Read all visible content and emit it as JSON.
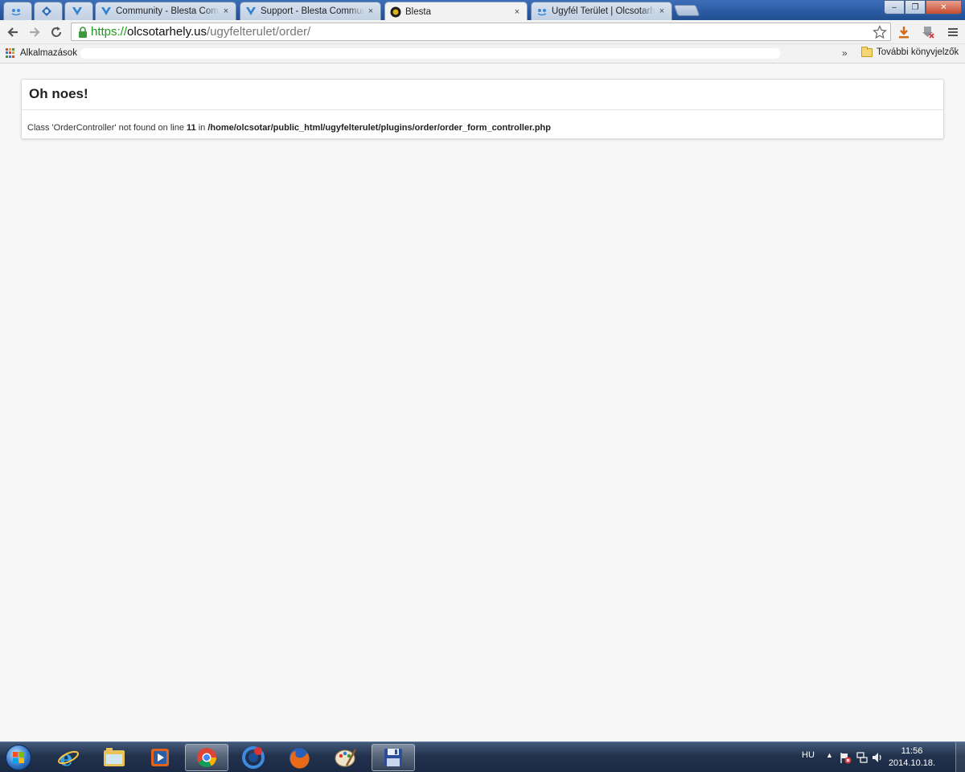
{
  "browser": {
    "tabs": [
      {
        "title": "",
        "pinned": true,
        "icon": "blesta-icon"
      },
      {
        "title": "",
        "pinned": true,
        "icon": "globe-icon"
      },
      {
        "title": "",
        "pinned": true,
        "icon": "blesta-v-icon"
      },
      {
        "title": "Community - Blesta Community",
        "icon": "blesta-v-icon",
        "active": false
      },
      {
        "title": "Support - Blesta Community",
        "icon": "blesta-v-icon",
        "active": false
      },
      {
        "title": "Blesta",
        "icon": "blesta-favicon",
        "active": true
      },
      {
        "title": "Ügyfél Terület | Olcsotarhely",
        "icon": "blesta-icon",
        "active": false
      }
    ],
    "close_glyph": "×",
    "window_controls": {
      "minimize": "‒",
      "maximize": "❐",
      "close": "✕"
    },
    "address": {
      "scheme": "https://",
      "host": "olcsotarhely.us",
      "path": "/ugyfelterulet/order/"
    },
    "bookmarks": {
      "apps_label": "Alkalmazások",
      "more_glyph": "»",
      "other_label": "További könyvjelzők"
    }
  },
  "page": {
    "error_title": "Oh noes!",
    "error_message": {
      "prefix": "Class 'OrderController' not found on line ",
      "line": "11",
      "middle": " in ",
      "file": "/home/olcsotar/public_html/ugyfelterulet/plugins/order/order_form_controller.php"
    }
  },
  "taskbar": {
    "apps": [
      "start-orb",
      "internet-explorer-icon",
      "file-explorer-icon",
      "media-player-icon",
      "chrome-icon",
      "update-icon",
      "firefox-icon",
      "paint-icon",
      "save-disk-icon"
    ],
    "active_app": "chrome-icon",
    "language": "HU",
    "tray_expand": "▲",
    "time": "11:56",
    "date": "2014.10.18."
  },
  "colors": {
    "url_scheme": "#1a9a1a",
    "page_background": "#f7f7f7",
    "taskbar": "#22324c"
  }
}
